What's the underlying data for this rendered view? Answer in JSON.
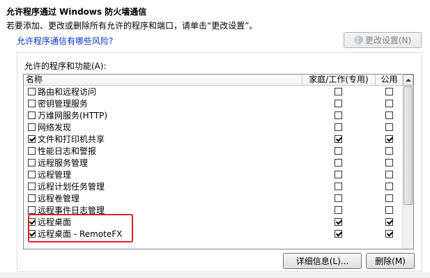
{
  "header": {
    "title": "允许程序通过 Windows 防火墙通信",
    "description": "若要添加、更改或删除所有允许的程序和端口，请单击“更改设置”。",
    "risk_link": "允许程序通信有哪些风险?",
    "change_settings_label": "更改设置(N)"
  },
  "group": {
    "label": "允许的程序和功能(A):",
    "columns": {
      "name": "名称",
      "home_work": "家庭/工作(专用)",
      "public": "公用"
    },
    "rows": [
      {
        "name": "路由和远程访问",
        "enabled": false,
        "home_work": false,
        "public": false
      },
      {
        "name": "密钥管理服务",
        "enabled": false,
        "home_work": false,
        "public": false
      },
      {
        "name": "万维网服务(HTTP)",
        "enabled": false,
        "home_work": false,
        "public": false
      },
      {
        "name": "网络发现",
        "enabled": false,
        "home_work": false,
        "public": false
      },
      {
        "name": "文件和打印机共享",
        "enabled": true,
        "home_work": true,
        "public": true
      },
      {
        "name": "性能日志和警报",
        "enabled": false,
        "home_work": false,
        "public": false
      },
      {
        "name": "远程服务管理",
        "enabled": false,
        "home_work": false,
        "public": false
      },
      {
        "name": "远程管理",
        "enabled": false,
        "home_work": false,
        "public": false
      },
      {
        "name": "远程计划任务管理",
        "enabled": false,
        "home_work": false,
        "public": false
      },
      {
        "name": "远程卷管理",
        "enabled": false,
        "home_work": false,
        "public": false
      },
      {
        "name": "远程事件日志管理",
        "enabled": false,
        "home_work": false,
        "public": false
      },
      {
        "name": "远程桌面",
        "enabled": true,
        "home_work": true,
        "public": true
      },
      {
        "name": "远程桌面 - RemoteFX",
        "enabled": true,
        "home_work": true,
        "public": true
      }
    ],
    "details_button": "详细信息(L)...",
    "remove_button": "删除(M)"
  }
}
